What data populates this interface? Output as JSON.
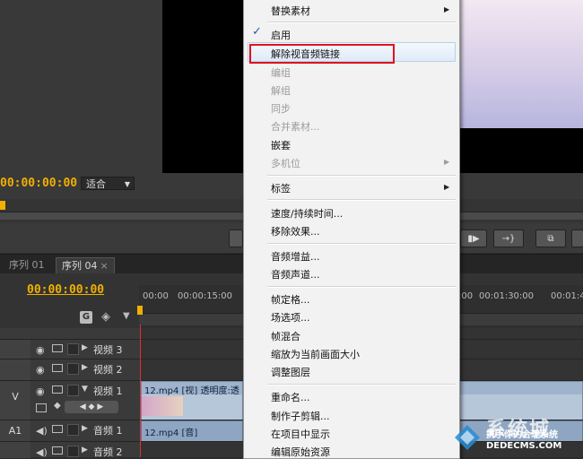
{
  "monitor": {
    "timecode": "00:00:00:00",
    "fit_select": "适合"
  },
  "timeline": {
    "tabs": [
      {
        "label": "序列 01"
      },
      {
        "label": "序列 04",
        "close": "×"
      }
    ],
    "timecode": "00:00:00:00",
    "ruler_ticks": [
      "00:00",
      "00:00:15:00",
      ":00",
      "00:01:30:00",
      "00:01:4"
    ],
    "tracks": [
      {
        "label": "",
        "name": "视频 3"
      },
      {
        "label": "",
        "name": "视频 2"
      },
      {
        "label": "V",
        "name": "视频 1"
      },
      {
        "label": "A1",
        "name": "音频 1"
      },
      {
        "label": "",
        "name": "音频 2"
      }
    ],
    "video_clip_label": "12.mp4 [视] 透明度:透",
    "audio_clip_label": "12.mp4 [音]"
  },
  "context_menu": {
    "items": [
      {
        "label": "替换素材",
        "disabled": false,
        "submenu": true
      },
      {
        "label": "启用",
        "disabled": false,
        "checked": true
      },
      {
        "label": "解除视音频链接",
        "disabled": false,
        "highlighted": true
      },
      {
        "label": "编组",
        "disabled": true
      },
      {
        "label": "解组",
        "disabled": true
      },
      {
        "label": "同步",
        "disabled": true
      },
      {
        "label": "合并素材...",
        "disabled": true
      },
      {
        "label": "嵌套",
        "disabled": false
      },
      {
        "label": "多机位",
        "disabled": true,
        "submenu": true
      },
      {
        "label": "标签",
        "disabled": false,
        "submenu": true
      },
      {
        "label": "速度/持续时间...",
        "disabled": false
      },
      {
        "label": "移除效果...",
        "disabled": false
      },
      {
        "label": "音频增益...",
        "disabled": false
      },
      {
        "label": "音频声道...",
        "disabled": false
      },
      {
        "label": "帧定格...",
        "disabled": false
      },
      {
        "label": "场选项...",
        "disabled": false
      },
      {
        "label": "帧混合",
        "disabled": false
      },
      {
        "label": "缩放为当前画面大小",
        "disabled": false
      },
      {
        "label": "调整图层",
        "disabled": false
      },
      {
        "label": "重命名...",
        "disabled": false
      },
      {
        "label": "制作子剪辑...",
        "disabled": false
      },
      {
        "label": "在项目中显示",
        "disabled": false
      },
      {
        "label": "编辑原始资源",
        "disabled": false
      }
    ],
    "checkmark": "✓",
    "submenu_arrow": "▶"
  },
  "watermark": {
    "brand": "系统城",
    "subtitle": "携手你的合理系统",
    "url": "DEDECMS.COM"
  },
  "colors": {
    "timecode": "#f0b000",
    "highlight_box": "#e0131c",
    "playhead": "#e03030"
  }
}
